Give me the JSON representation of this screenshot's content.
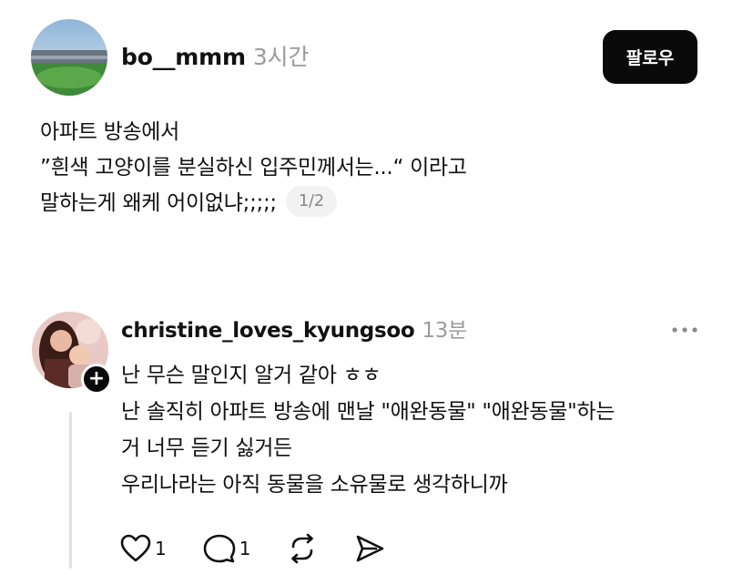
{
  "post": {
    "username": "bo__mmm",
    "time": "3시간",
    "follow_label": "팔로우",
    "lines": [
      "아파트 방송에서",
      "”흰색 고양이를 분실하신 입주민께서는...“ 이라고",
      "말하는게 왜케 어이없냐;;;;;"
    ],
    "page_indicator": "1/2"
  },
  "reply": {
    "username": "christine_loves_kyungsoo",
    "time": "13분",
    "lines": [
      "난 무슨 말인지 알거 같아 ㅎㅎ",
      "난 솔직히 아파트 방송에 맨날 \"애완동물\" \"애완동물\"하는",
      "거 너무 듣기 싫거든",
      "우리나라는 아직 동물을 소유물로 생각하니까"
    ],
    "likes": "1",
    "comments": "1"
  },
  "icons": {
    "like": "heart-icon",
    "comment": "comment-bubble-icon",
    "repost": "repost-icon",
    "share": "send-icon",
    "more": "more-dots-icon",
    "follow_plus": "plus-icon"
  }
}
